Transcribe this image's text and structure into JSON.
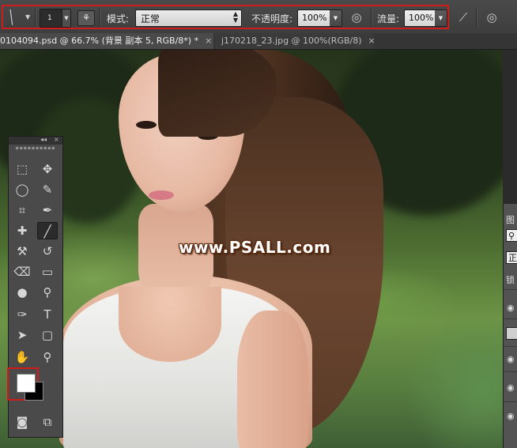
{
  "options_bar": {
    "brush_size": "1",
    "mode_label": "模式:",
    "mode_value": "正常",
    "opacity_label": "不透明度:",
    "opacity_value": "100%",
    "flow_label": "流量:",
    "flow_value": "100%",
    "highlight_color": "#d11c1c"
  },
  "tabs": [
    {
      "label": "0104094.psd @ 66.7% (背景 副本 5, RGB/8*) *",
      "close": "×"
    },
    {
      "label": "j170218_23.jpg @ 100%(RGB/8)",
      "close": "×"
    }
  ],
  "canvas": {
    "watermark": "www.PSALL.com"
  },
  "tools_panel": {
    "collapse": "◂◂",
    "close": "×",
    "grip": "▪▪▪▪▪▪▪▪▪▪",
    "selected_tool": "brush-tool",
    "foreground_color": "#ffffff",
    "background_color": "#000000"
  },
  "right_panel": {
    "tab_label": "图",
    "field_value": "正",
    "lock_label": "锁"
  }
}
